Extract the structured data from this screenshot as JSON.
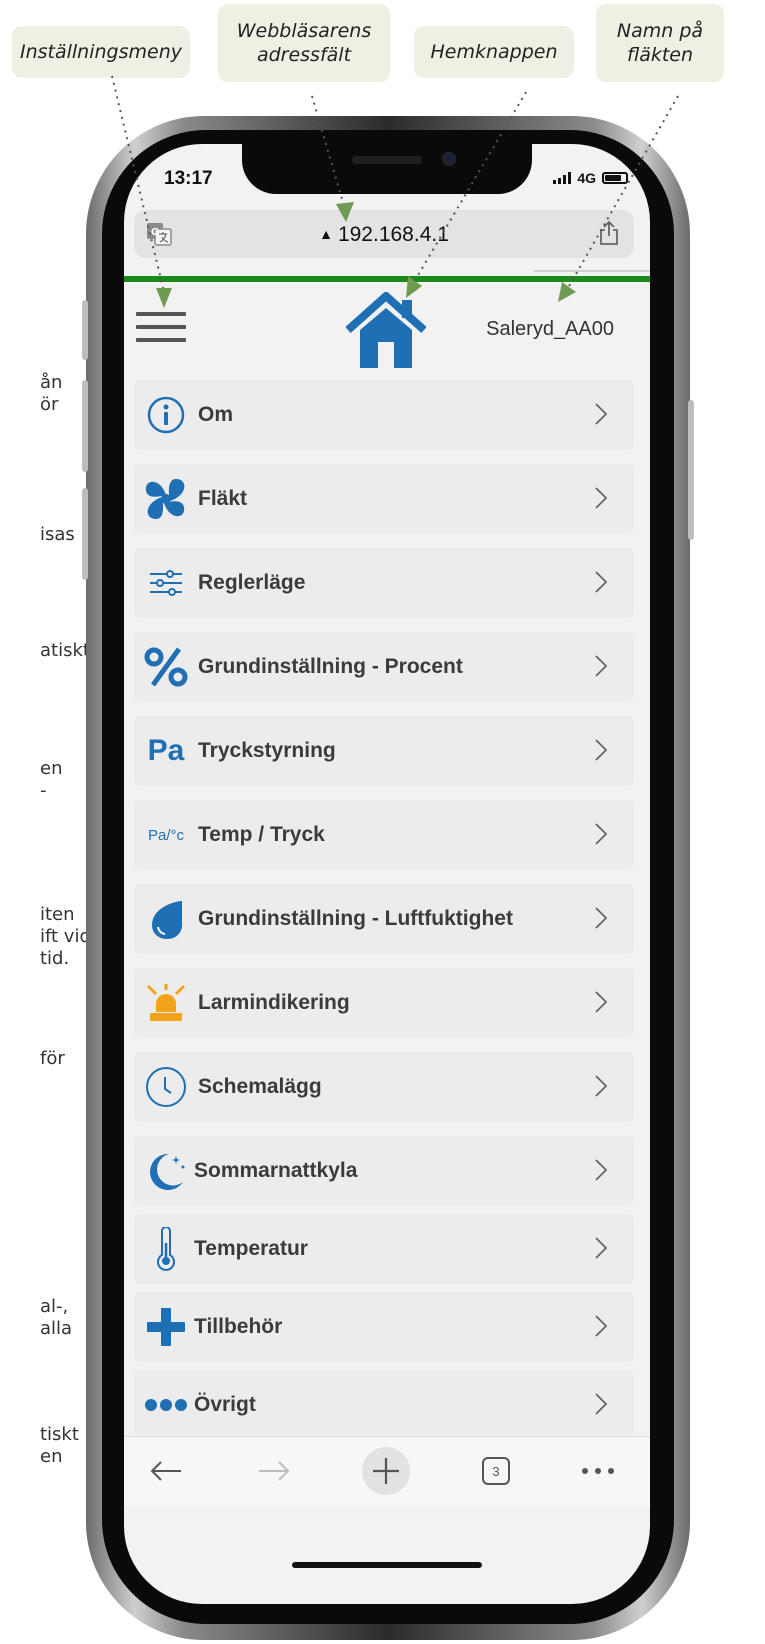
{
  "callouts": {
    "settings_menu": "Inställningsmeny",
    "address_bar_line1": "Webbläsarens",
    "address_bar_line2": "adressfält",
    "home_button": "Hemknappen",
    "fan_name_line1": "Namn på",
    "fan_name_line2": "fläkten"
  },
  "margin_fragments": [
    "ån\nör",
    "isas",
    "atiskt",
    "en\n-",
    "iten\nift vid\ntid.",
    "för",
    "al-,\nalla",
    "tiskt\nen"
  ],
  "status": {
    "time": "13:17",
    "network": "4G",
    "battery_level": 0.8
  },
  "browser": {
    "url": "192.168.4.1",
    "open_tabs": "3"
  },
  "header": {
    "fan_name": "Saleryd_AA00"
  },
  "menu": [
    {
      "label": "Om",
      "icon": "info-icon"
    },
    {
      "label": "Fläkt",
      "icon": "fan-icon"
    },
    {
      "label": "Reglerläge",
      "icon": "sliders-icon"
    },
    {
      "label": "Grundinställning - Procent",
      "icon": "percent-icon"
    },
    {
      "label": "Tryckstyrning",
      "icon": "pressure-icon"
    },
    {
      "label": "Temp / Tryck",
      "icon": "temp-pressure-icon"
    },
    {
      "label": "Grundinställning - Luftfuktighet",
      "icon": "droplet-icon"
    },
    {
      "label": "Larmindikering",
      "icon": "alarm-light-icon"
    },
    {
      "label": "Schemalägg",
      "icon": "clock-icon"
    },
    {
      "label": "Sommarnattkyla",
      "icon": "moon-icon"
    },
    {
      "label": "Temperatur",
      "icon": "thermometer-icon"
    },
    {
      "label": "Tillbehör",
      "icon": "plus-icon"
    },
    {
      "label": "Övrigt",
      "icon": "more-dots-icon"
    }
  ],
  "icon_text": {
    "pressure": "Pa",
    "temp_pressure": "Pa/°c"
  },
  "colors": {
    "accent_blue": "#1f6fb5",
    "alarm_orange": "#f2a31b",
    "url_green": "#1a8a1a"
  }
}
